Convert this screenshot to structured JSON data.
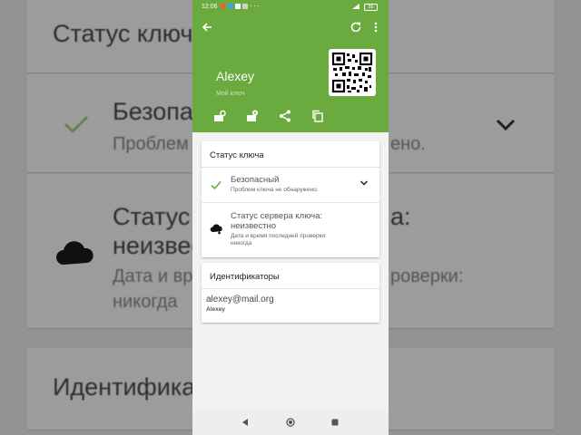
{
  "status_bar": {
    "time": "12:06",
    "more_indicator": "···",
    "battery": "55"
  },
  "header": {
    "user_name": "Alexey",
    "subtitle": "Мой ключ",
    "back_icon": "arrow-left-icon",
    "refresh_icon": "refresh-icon",
    "more_icon": "more-vert-icon"
  },
  "key_status": {
    "title": "Статус ключа",
    "safe": {
      "title": "Безопасный",
      "subtitle": "Проблем ключа не обнаружено."
    },
    "server": {
      "title_line1": "Статус сервера ключа:",
      "title_line2": "неизвестно",
      "subtitle_line1": "Дата и время последней проверки:",
      "subtitle_line2": "никогда"
    }
  },
  "identifiers": {
    "title": "Идентификаторы",
    "email": "alexey@mail.org",
    "name": "Alexey"
  },
  "background": {
    "line1": "Статус ключ",
    "line2": "Безопас",
    "line3": "Проблем",
    "line3b": "ено.",
    "line4": "Статус",
    "line4b": "а:",
    "line5": "неизвест",
    "line6": "Дата и вр",
    "line6b": "роверки:",
    "line7": "никогда",
    "line8": "Идентифика"
  },
  "colors": {
    "brand_green": "#6aaa3f",
    "check_green": "#6aaa3f"
  }
}
